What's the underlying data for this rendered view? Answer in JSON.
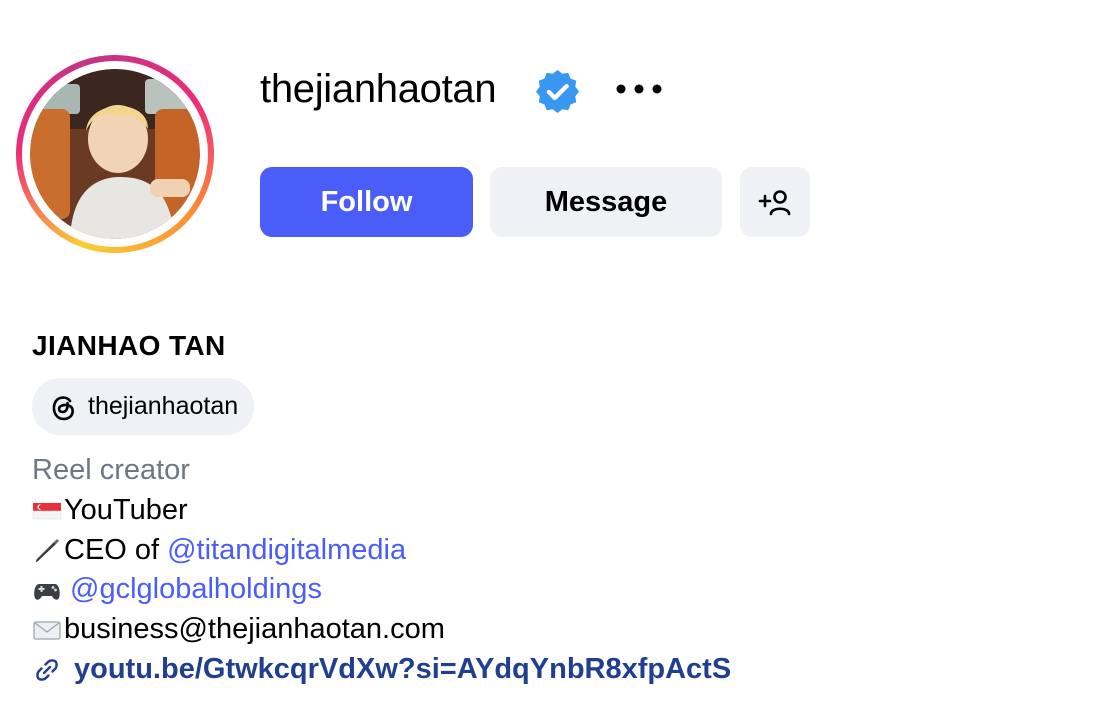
{
  "profile": {
    "username": "thejianhaotan",
    "full_name": "JIANHAO TAN",
    "verified": true,
    "threads_handle": "thejianhaotan"
  },
  "actions": {
    "follow_label": "Follow",
    "message_label": "Message"
  },
  "bio": {
    "category": "Reel creator",
    "line1": "YouTuber",
    "line2_prefix": "CEO of ",
    "line2_mention": "@titandigitalmedia",
    "line3_mention": "@gclglobalholdings",
    "line4": "business@thejianhaotan.com",
    "link": "youtu.be/GtwkcqrVdXw?si=AYdqYnbR8xfpActS"
  },
  "icons": {
    "verified": "verified-badge-icon",
    "more": "more-options-icon",
    "add_user": "add-user-icon",
    "threads": "threads-icon",
    "link": "link-icon"
  },
  "colors": {
    "accent": "#4a5df9",
    "button_secondary": "#eff1f5",
    "verified": "#3897f0",
    "muted_text": "#6f7782",
    "link_text": "#213f91"
  }
}
